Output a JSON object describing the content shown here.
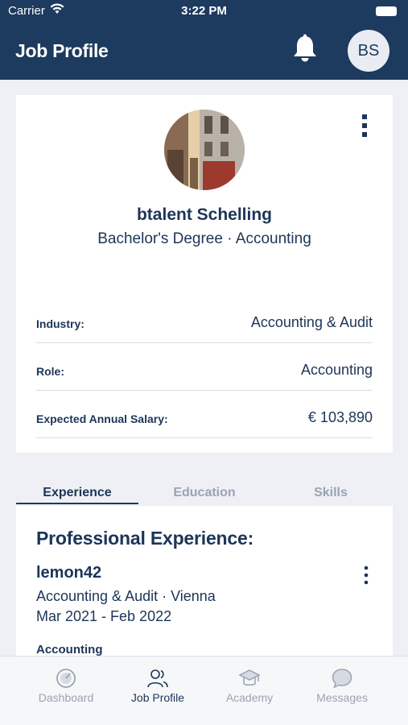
{
  "status_bar": {
    "carrier": "Carrier",
    "time": "3:22 PM"
  },
  "header": {
    "title": "Job Profile",
    "avatar_initials": "BS"
  },
  "profile": {
    "name": "btalent Schelling",
    "degree": "Bachelor's Degree · Accounting",
    "fields": [
      {
        "label": "Industry:",
        "value": "Accounting & Audit"
      },
      {
        "label": "Role:",
        "value": "Accounting"
      },
      {
        "label": "Expected Annual Salary:",
        "value": "€ 103,890"
      }
    ]
  },
  "tabs": [
    {
      "label": "Experience",
      "active": true
    },
    {
      "label": "Education",
      "active": false
    },
    {
      "label": "Skills",
      "active": false
    }
  ],
  "experience": {
    "section_title": "Professional Experience:",
    "entries": [
      {
        "company": "lemon42",
        "industry_location": "Accounting & Audit · Vienna",
        "period": "Mar 2021 - Feb 2022",
        "role": "Accounting"
      }
    ]
  },
  "tab_bar": {
    "items": [
      {
        "label": "Dashboard",
        "icon": "dashboard-icon",
        "active": false
      },
      {
        "label": "Job Profile",
        "icon": "people-icon",
        "active": true
      },
      {
        "label": "Academy",
        "icon": "graduation-cap-icon",
        "active": false
      },
      {
        "label": "Messages",
        "icon": "chat-bubble-icon",
        "active": false
      }
    ]
  },
  "colors": {
    "primary": "#1d3a5f",
    "text": "#1d3557",
    "inactive": "#9aa3b2",
    "background": "#eef0f5"
  }
}
